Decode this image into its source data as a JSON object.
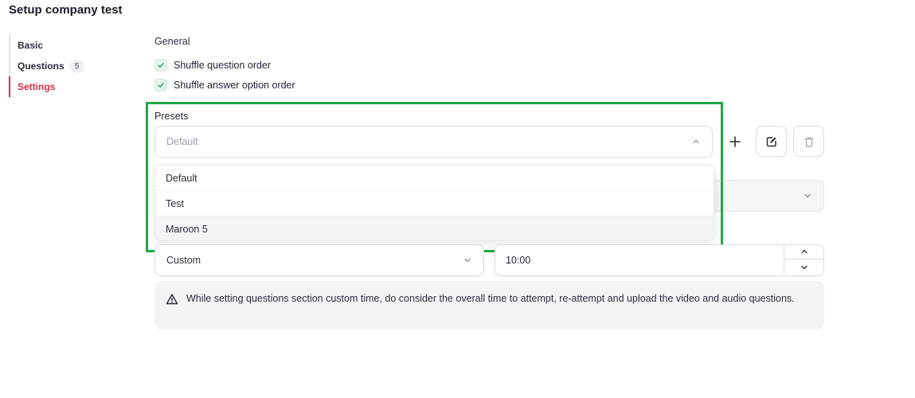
{
  "page": {
    "title": "Setup company test"
  },
  "sidebar": {
    "items": [
      {
        "label": "Basic",
        "active": false
      },
      {
        "label": "Questions",
        "badge": "5",
        "active": false
      },
      {
        "label": "Settings",
        "active": true
      }
    ]
  },
  "general": {
    "label": "General",
    "options": [
      {
        "label": "Shuffle question order",
        "checked": true
      },
      {
        "label": "Shuffle answer option order",
        "checked": true
      }
    ]
  },
  "presets": {
    "label": "Presets",
    "selected": "Default",
    "options": [
      "Default",
      "Test",
      "Maroon 5"
    ],
    "actions": {
      "add": "plus-icon",
      "edit": "edit-icon",
      "delete": "trash-icon"
    }
  },
  "timing": {
    "mode": "Custom",
    "time_value": "10:00"
  },
  "info": {
    "text": "While setting questions section custom time, do consider the overall time to attempt, re-attempt and upload the video and audio questions."
  },
  "colors": {
    "accent": "#d32f4a",
    "highlight": "#1fa845",
    "check_bg": "#e4f4ea",
    "check_mark": "#27a05a"
  }
}
